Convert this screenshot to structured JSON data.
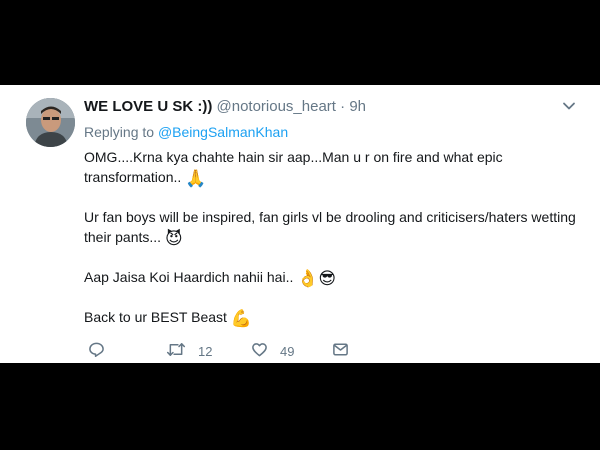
{
  "tweet": {
    "display_name": "WE LOVE U SK :))",
    "handle": "@notorious_heart",
    "separator": "·",
    "time": "9h",
    "replying_prefix": "Replying to",
    "replying_to": "@BeingSalmanKhan",
    "paragraphs": [
      {
        "text": "OMG....Krna kya chahte hain sir aap...Man u r on fire and what epic transformation..",
        "emoji": "🙏"
      },
      {
        "text": "Ur fan boys will be inspired, fan girls vl be drooling and criticisers/haters wetting their pants...",
        "emoji": "😈"
      },
      {
        "text": "Aap Jaisa Koi Haardich nahii hai..",
        "emoji": "👌😎"
      },
      {
        "text": "Back to ur BEST Beast",
        "emoji": "💪"
      }
    ]
  },
  "actions": {
    "reply_icon": "reply-icon",
    "retweet_icon": "retweet-icon",
    "retweet_count": "12",
    "like_icon": "heart-icon",
    "like_count": "49",
    "message_icon": "envelope-icon"
  },
  "colors": {
    "text": "#14171a",
    "muted": "#657786",
    "link": "#1da1f2",
    "background": "#ffffff",
    "letterbox": "#000000"
  }
}
